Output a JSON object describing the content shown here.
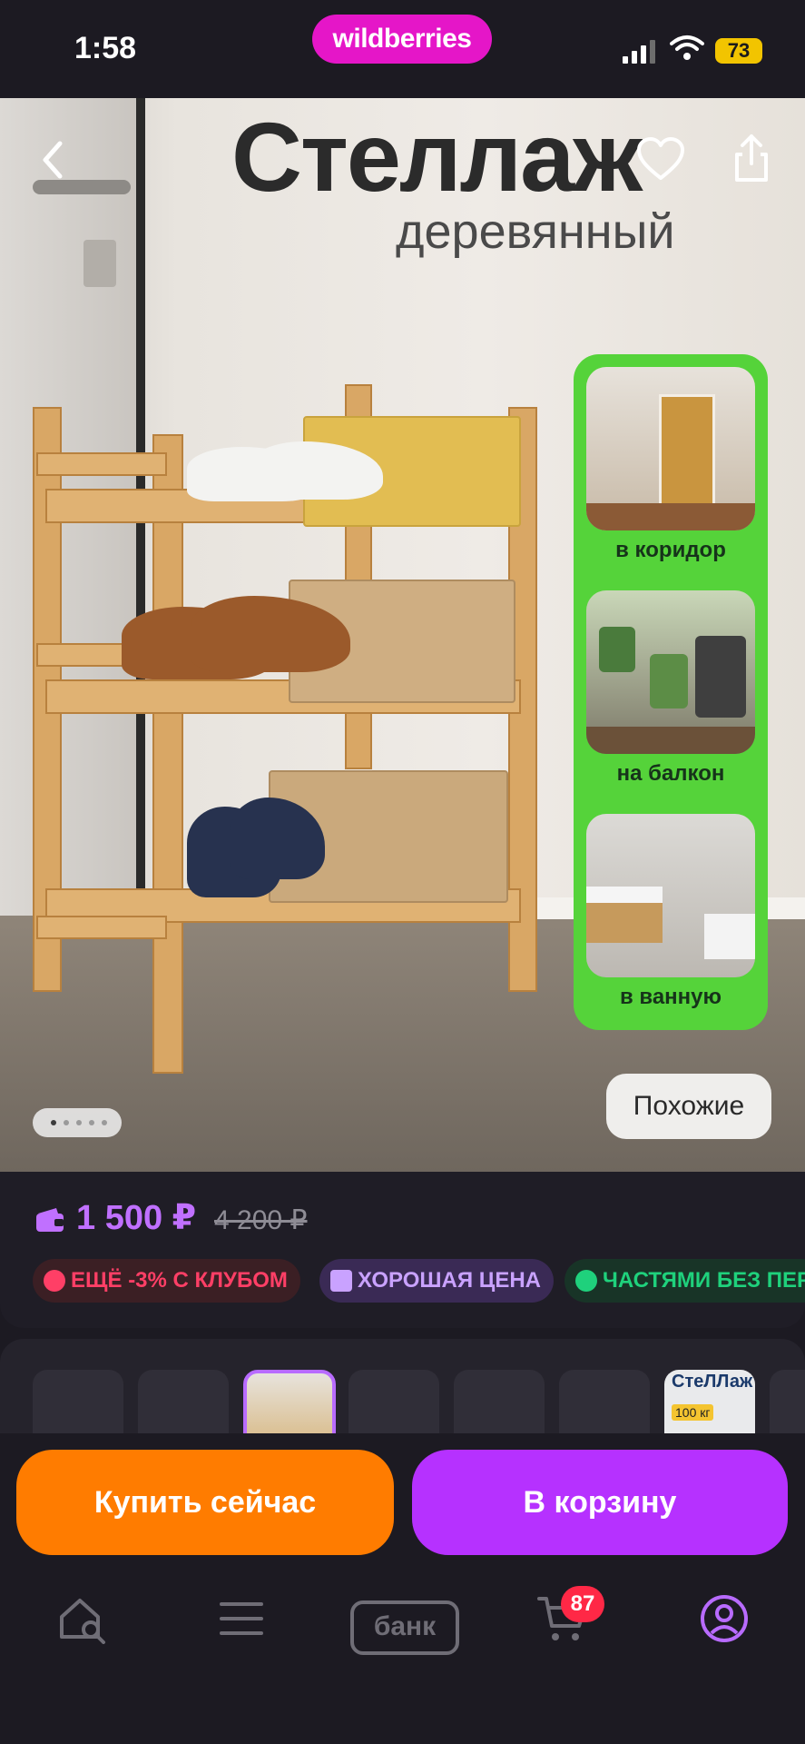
{
  "status": {
    "time": "1:58",
    "brand": "wildberries",
    "battery": "73"
  },
  "hero": {
    "title": "Стеллаж",
    "subtitle": "деревянный",
    "tiles": [
      "в коридор",
      "на балкон",
      "в ванную"
    ],
    "similar_label": "Похожие"
  },
  "price": {
    "current": "1 500 ₽",
    "old": "4 200 ₽"
  },
  "badges": [
    "ЕЩЁ -3% С КЛУБОМ",
    "ХОРОШАЯ ЦЕНА",
    "ЧАСТЯМИ БЕЗ ПЕР"
  ],
  "thumbs": {
    "last_label": "СтеЛЛаж",
    "last_tag": "100 кг"
  },
  "actions": {
    "buy_now": "Купить сейчас",
    "add_to_cart": "В корзину"
  },
  "nav": {
    "bank": "банк",
    "cart_count": "87"
  },
  "colors": {
    "accent": "#b631ff",
    "buy": "#ff7c00",
    "panel_green": "#55d33a",
    "badge_red": "#ff2846"
  }
}
